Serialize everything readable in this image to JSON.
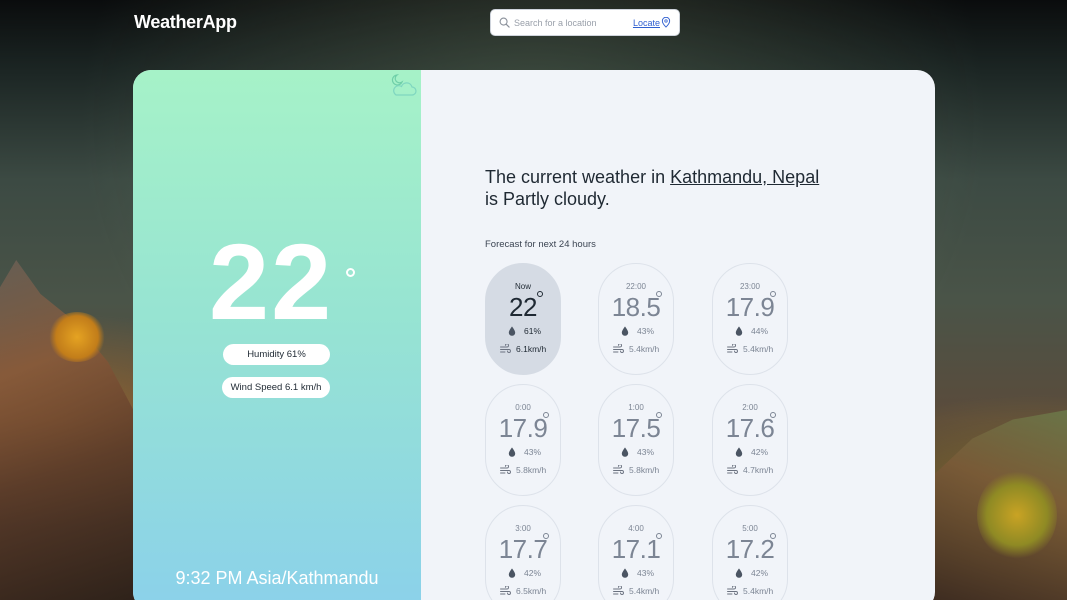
{
  "app": {
    "title": "WeatherApp"
  },
  "search": {
    "placeholder": "Search for a location",
    "value": "",
    "locate_label": "Locate"
  },
  "current": {
    "temperature": "22",
    "humidity_label": "Humidity 61%",
    "wind_label": "Wind Speed 6.1 km/h",
    "time_zone": "9:32 PM Asia/Kathmandu",
    "icon": "moon-cloud-icon"
  },
  "headline": {
    "prefix": "The current weather in",
    "location": "Kathmandu, Nepal",
    "suffix": "is Partly cloudy."
  },
  "forecast": {
    "label": "Forecast for next 24 hours",
    "hours": [
      {
        "time": "Now",
        "temp": "22",
        "humidity": "61%",
        "wind": "6.1km/h"
      },
      {
        "time": "22:00",
        "temp": "18.5",
        "humidity": "43%",
        "wind": "5.4km/h"
      },
      {
        "time": "23:00",
        "temp": "17.9",
        "humidity": "44%",
        "wind": "5.4km/h"
      },
      {
        "time": "0:00",
        "temp": "17.9",
        "humidity": "43%",
        "wind": "5.8km/h"
      },
      {
        "time": "1:00",
        "temp": "17.5",
        "humidity": "43%",
        "wind": "5.8km/h"
      },
      {
        "time": "2:00",
        "temp": "17.6",
        "humidity": "42%",
        "wind": "4.7km/h"
      },
      {
        "time": "3:00",
        "temp": "17.7",
        "humidity": "42%",
        "wind": "6.5km/h"
      },
      {
        "time": "4:00",
        "temp": "17.1",
        "humidity": "43%",
        "wind": "5.4km/h"
      },
      {
        "time": "5:00",
        "temp": "17.2",
        "humidity": "42%",
        "wind": "5.4km/h"
      }
    ]
  },
  "colors": {
    "accent": "#2f5fd0",
    "panel_top": "#a6f2c8",
    "panel_bottom": "#8bd1ea",
    "card_bg": "#f1f4f9"
  }
}
